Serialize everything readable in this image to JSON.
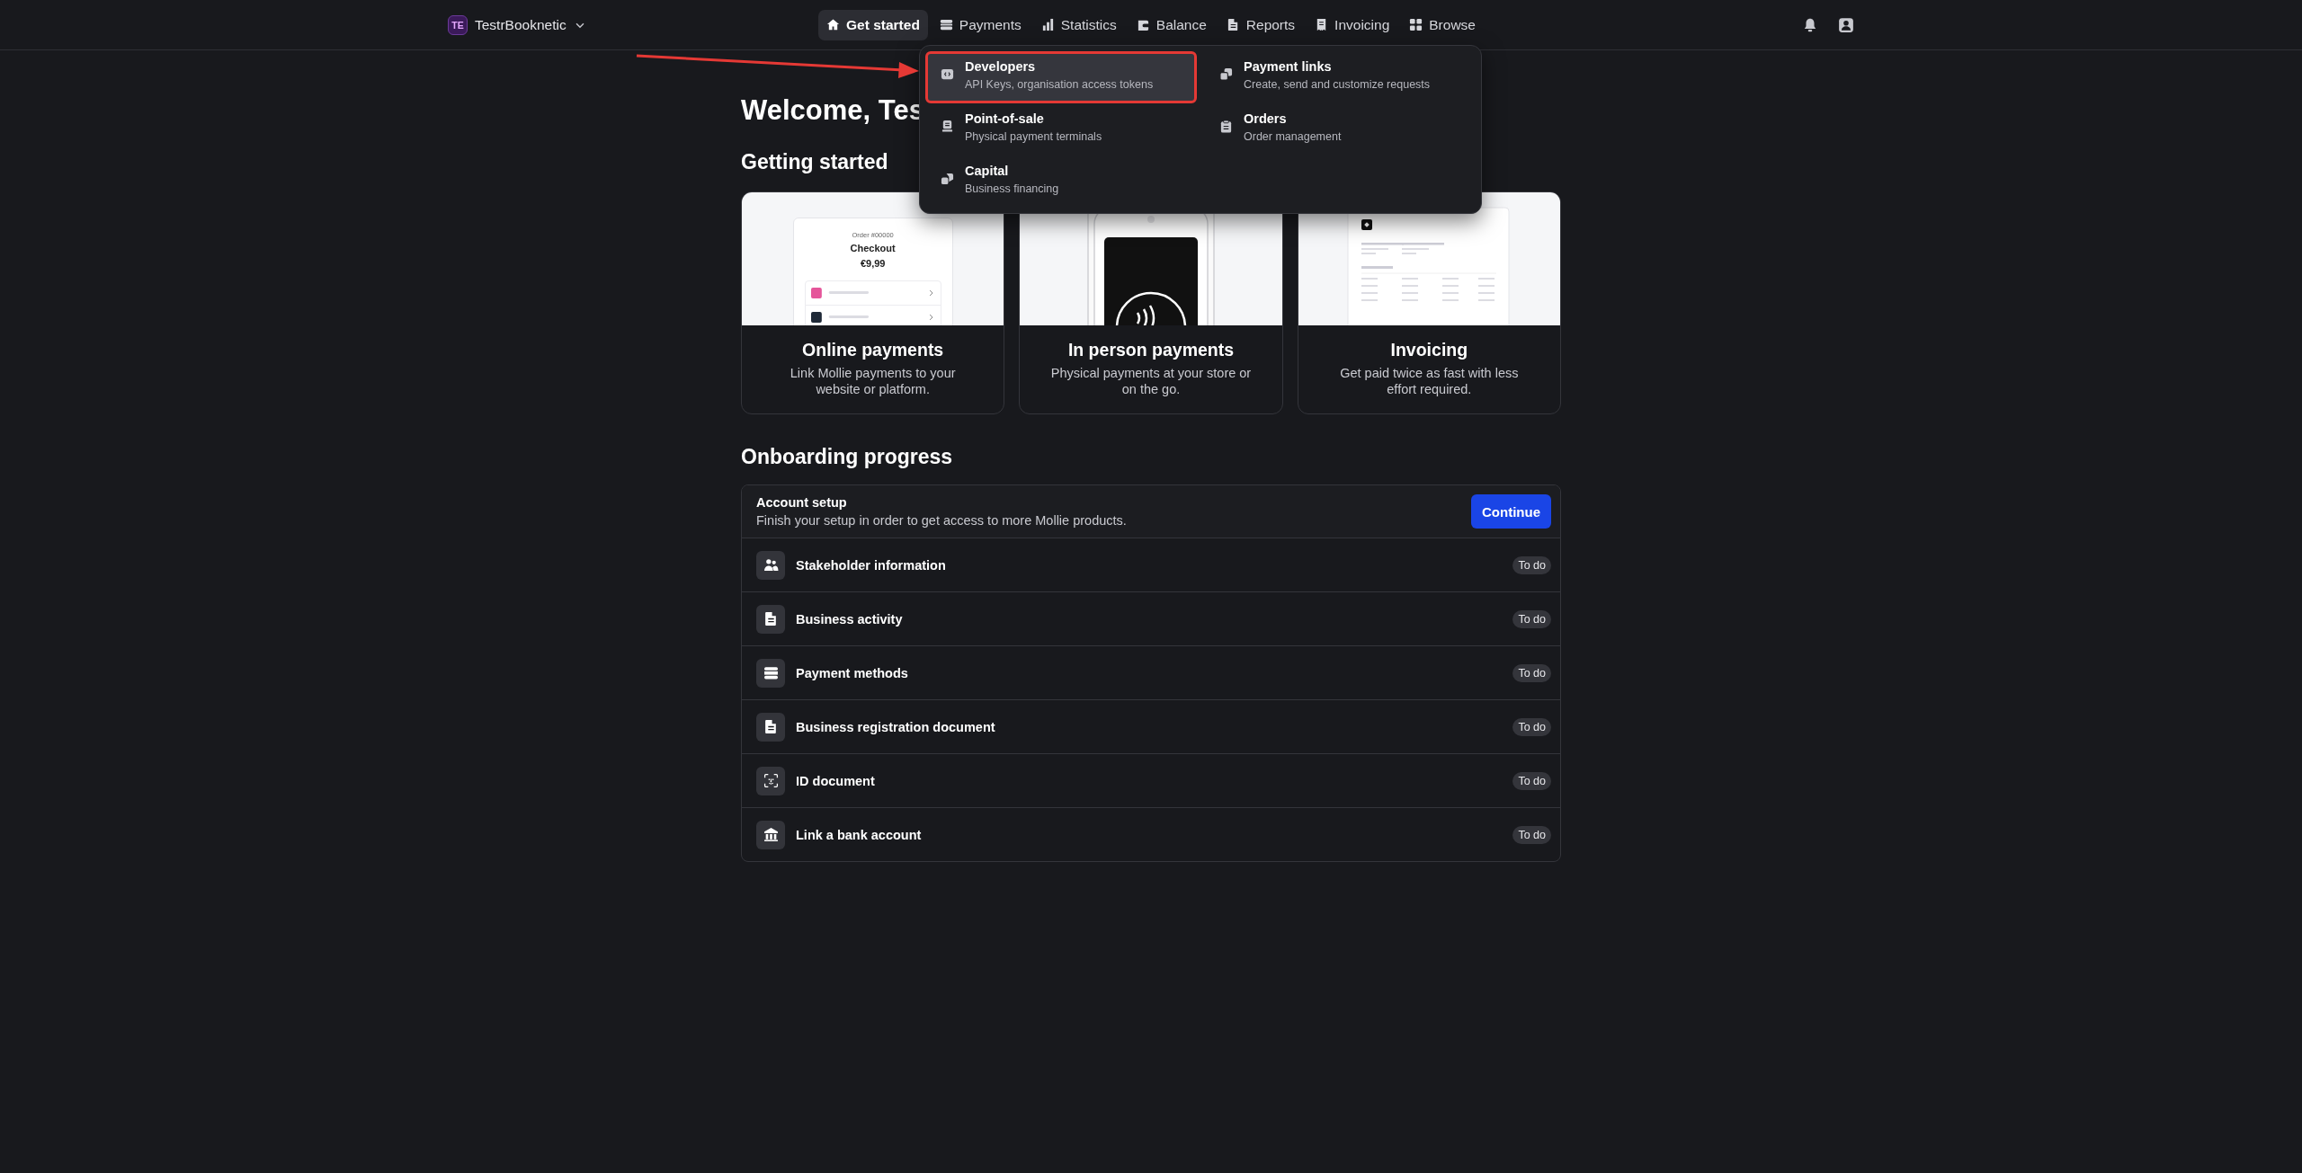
{
  "header": {
    "workspace": {
      "initials": "TE",
      "name": "TestrBooknetic"
    },
    "nav": [
      {
        "label": "Get started",
        "selected": true
      },
      {
        "label": "Payments",
        "selected": false
      },
      {
        "label": "Statistics",
        "selected": false
      },
      {
        "label": "Balance",
        "selected": false
      },
      {
        "label": "Reports",
        "selected": false
      },
      {
        "label": "Invoicing",
        "selected": false
      },
      {
        "label": "Browse",
        "selected": false
      }
    ]
  },
  "menu": {
    "items": [
      {
        "title": "Developers",
        "description": "API Keys, organisation access tokens",
        "highlighted": true
      },
      {
        "title": "Payment links",
        "description": "Create, send and customize requests",
        "highlighted": false
      },
      {
        "title": "Point-of-sale",
        "description": "Physical payment terminals",
        "highlighted": false
      },
      {
        "title": "Orders",
        "description": "Order management",
        "highlighted": false
      },
      {
        "title": "Capital",
        "description": "Business financing",
        "highlighted": false
      }
    ]
  },
  "welcome_title": "Welcome, Tes",
  "getting_started": {
    "heading": "Getting started",
    "cards": [
      {
        "kind": "checkout",
        "title": "Online payments",
        "description": "Link Mollie payments to your website or platform.",
        "preview": {
          "order": "Order #00000",
          "heading": "Checkout",
          "amount": "€9,99"
        }
      },
      {
        "kind": "terminal",
        "title": "In person payments",
        "description": "Physical payments at your store or on the go."
      },
      {
        "kind": "invoice",
        "title": "Invoicing",
        "description": "Get paid twice as fast with less effort required."
      }
    ]
  },
  "onboarding": {
    "heading": "Onboarding progress",
    "setup": {
      "title": "Account setup",
      "description": "Finish your setup in order to get access to more Mollie products.",
      "button": "Continue"
    },
    "steps": [
      {
        "label": "Stakeholder information",
        "status": "To do"
      },
      {
        "label": "Business activity",
        "status": "To do"
      },
      {
        "label": "Payment methods",
        "status": "To do"
      },
      {
        "label": "Business registration document",
        "status": "To do"
      },
      {
        "label": "ID document",
        "status": "To do"
      },
      {
        "label": "Link a bank account",
        "status": "To do"
      }
    ]
  }
}
